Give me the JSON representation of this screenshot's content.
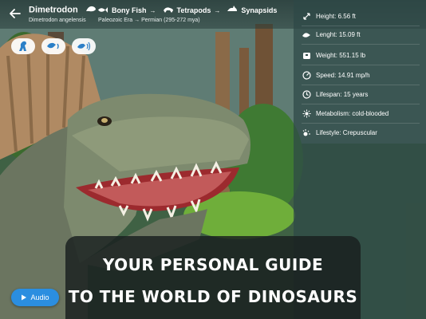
{
  "header": {
    "title": "Dimetrodon",
    "species": "Dimetrodon angelensis",
    "taxonomy": [
      {
        "label": "Bony Fish",
        "icon": "fish-icon"
      },
      {
        "label": "Tetrapods",
        "icon": "tetrapod-icon"
      },
      {
        "label": "Synapsids",
        "icon": "synapsid-icon"
      }
    ],
    "era": "Paleozoic Era → Permian",
    "era_range": "(295-272 mya)"
  },
  "stats": [
    {
      "icon": "height-icon",
      "text": "Height: 6.56 ft"
    },
    {
      "icon": "length-icon",
      "text": "Lenght: 15.09 ft"
    },
    {
      "icon": "weight-icon",
      "text": "Weight: 551.15 lb"
    },
    {
      "icon": "speed-icon",
      "text": "Speed: 14.91 mp/h"
    },
    {
      "icon": "lifespan-icon",
      "text": "Lifespan: 15 years"
    },
    {
      "icon": "metabolism-icon",
      "text": "Metabolism: cold-blooded"
    },
    {
      "icon": "lifestyle-icon",
      "text": "Lifestyle: Crepuscular"
    }
  ],
  "banner": {
    "line1": "YOUR PERSONAL GUIDE",
    "line2": "TO THE WORLD OF DINOSAURS"
  },
  "audio_button": {
    "label": "Audio"
  },
  "colors": {
    "accent": "#2b8ee0",
    "panel": "#2e4846"
  }
}
